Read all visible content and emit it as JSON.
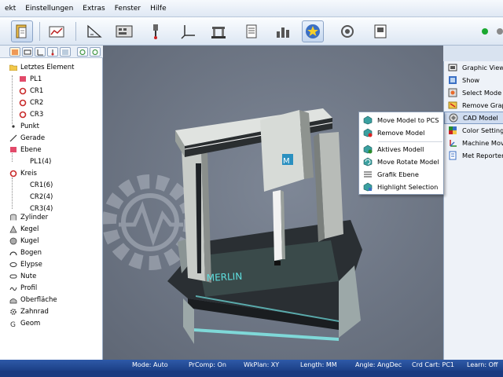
{
  "menu": {
    "items": [
      "ekt",
      "Einstellungen",
      "Extras",
      "Fenster",
      "Hilfe"
    ]
  },
  "toolbar": {
    "buttons": [
      "document-icon",
      "graph-icon",
      "triangle-icon",
      "keyboard-icon",
      "probe-icon",
      "axes-icon",
      "machine-icon",
      "report-icon",
      "chart-icon",
      "star-icon",
      "refresh-icon",
      "screen-icon"
    ],
    "status_colors": [
      "#1aa830",
      "#8a8a8a"
    ]
  },
  "tree": {
    "items": [
      {
        "label": "Letztes Element",
        "icon": "folder-icon"
      },
      {
        "label": "PL1",
        "icon": "plane-icon"
      },
      {
        "label": "CR1",
        "icon": "circle-icon"
      },
      {
        "label": "CR2",
        "icon": "circle-icon"
      },
      {
        "label": "CR3",
        "icon": "circle-icon"
      },
      {
        "label": "Punkt",
        "icon": "point-icon"
      },
      {
        "label": "Gerade",
        "icon": "line-icon"
      },
      {
        "label": "Ebene",
        "icon": "plane-icon"
      },
      {
        "label": "PL1(4)",
        "icon": ""
      },
      {
        "label": "Kreis",
        "icon": "circle-icon"
      },
      {
        "label": "CR1(6)",
        "icon": ""
      },
      {
        "label": "CR2(4)",
        "icon": ""
      },
      {
        "label": "CR3(4)",
        "icon": ""
      },
      {
        "label": "Zylinder",
        "icon": "cylinder-icon"
      },
      {
        "label": "Kegel",
        "icon": "cone-icon"
      },
      {
        "label": "Kugel",
        "icon": "sphere-icon"
      },
      {
        "label": "Bogen",
        "icon": "arc-icon"
      },
      {
        "label": "Elypse",
        "icon": "ellipse-icon"
      },
      {
        "label": "Nute",
        "icon": "slot-icon"
      },
      {
        "label": "Profil",
        "icon": "profile-icon"
      },
      {
        "label": "Oberfläche",
        "icon": "surface-icon"
      },
      {
        "label": "Zahnrad",
        "icon": "gear-icon"
      },
      {
        "label": "Geom",
        "icon": "geom-icon"
      }
    ]
  },
  "viewport": {
    "machine_label": "MERLIN"
  },
  "right_menu": {
    "items": [
      {
        "label": "Graphic View",
        "icon": "graphic-view-icon"
      },
      {
        "label": "Show",
        "icon": "show-icon"
      },
      {
        "label": "Select Mode",
        "icon": "select-mode-icon"
      },
      {
        "label": "Remove Graph",
        "icon": "remove-graph-icon"
      },
      {
        "label": "CAD Model",
        "icon": "cad-model-icon",
        "selected": true
      },
      {
        "label": "Color Setting",
        "icon": "color-setting-icon"
      },
      {
        "label": "Machine Move",
        "icon": "machine-move-icon"
      },
      {
        "label": "Met Reporter",
        "icon": "met-reporter-icon"
      }
    ]
  },
  "context_menu": {
    "items": [
      {
        "label": "Move Model to PCS",
        "icon": "move-model-icon"
      },
      {
        "label": "Remove Model",
        "icon": "remove-model-icon"
      },
      {
        "label": "Aktives Modell",
        "icon": "active-model-icon"
      },
      {
        "label": "Move Rotate Model",
        "icon": "rotate-model-icon"
      },
      {
        "label": "Grafik Ebene",
        "icon": "graphic-plane-icon"
      },
      {
        "label": "Highlight Selection",
        "icon": "highlight-icon"
      }
    ]
  },
  "statusbar": {
    "mode": "Mode: Auto",
    "prcomp": "PrComp: On",
    "wkplan": "WkPlan: XY",
    "length": "Length: MM",
    "angle": "Angle: AngDec",
    "crd": "Crd Cart: PC1",
    "learn": "Learn: Off"
  }
}
